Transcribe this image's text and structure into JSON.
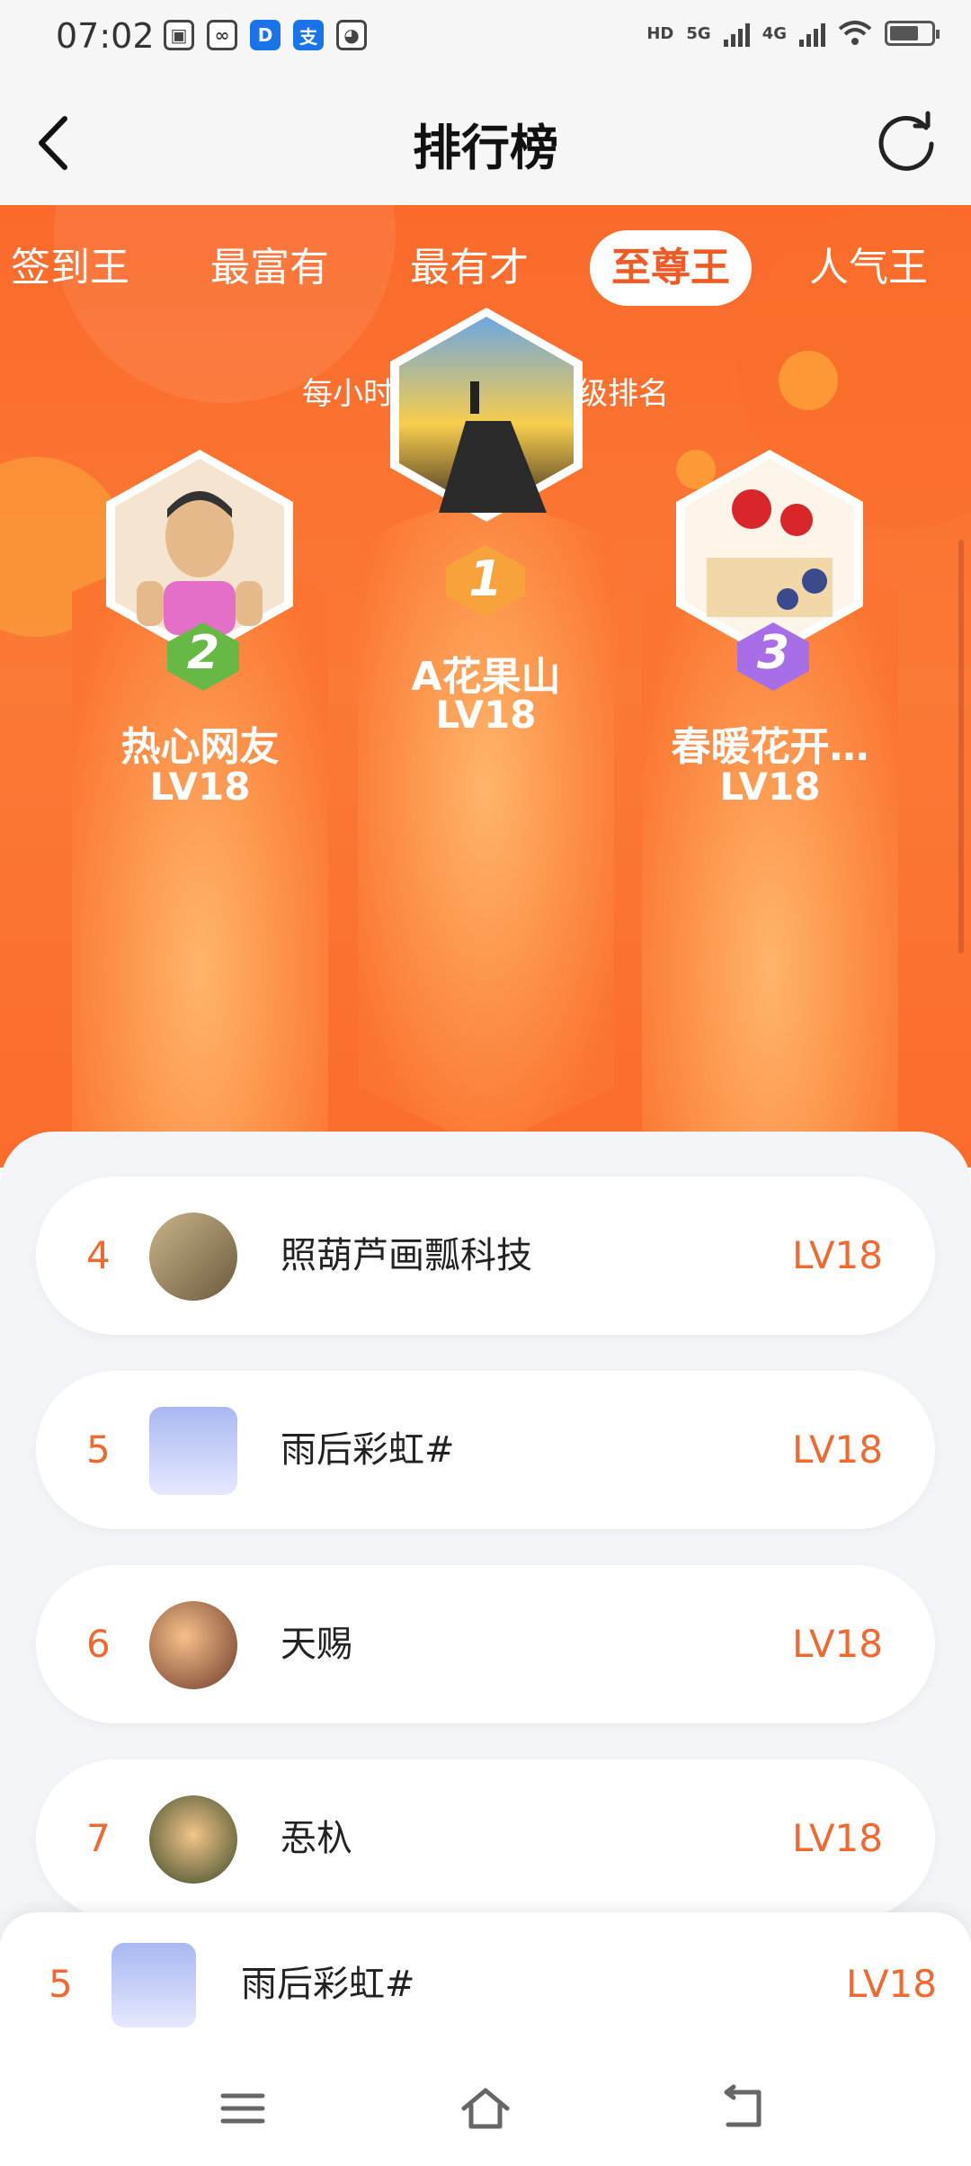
{
  "status_bar": {
    "time": "07:02",
    "notification_icons": [
      "app-icon",
      "ribbon-icon",
      "D",
      "支",
      "cat-icon"
    ],
    "network_left": "HD",
    "network_5g": "5G",
    "network_4g": "4G"
  },
  "header": {
    "title": "排行榜"
  },
  "tabs": [
    {
      "label": "签到王",
      "active": false
    },
    {
      "label": "最富有",
      "active": false
    },
    {
      "label": "最有才",
      "active": false
    },
    {
      "label": "至尊王",
      "active": true
    },
    {
      "label": "人气王",
      "active": false
    }
  ],
  "subtitle": "每小时更新一次，等级排名",
  "podium": {
    "first": {
      "rank": "1",
      "name": "A花果山",
      "level": "LV18"
    },
    "second": {
      "rank": "2",
      "name": "热心网友",
      "level": "LV18"
    },
    "third": {
      "rank": "3",
      "name": "春暖花开…",
      "level": "LV18"
    }
  },
  "list": [
    {
      "rank": "4",
      "name": "照葫芦画瓢科技",
      "level": "LV18"
    },
    {
      "rank": "5",
      "name": "雨后彩虹#",
      "level": "LV18"
    },
    {
      "rank": "6",
      "name": "天赐",
      "level": "LV18"
    },
    {
      "rank": "7",
      "name": "忢杁",
      "level": "LV18"
    }
  ],
  "my_rank": {
    "rank": "5",
    "name": "雨后彩虹#",
    "level": "LV18"
  },
  "colors": {
    "accent": "#f06a30",
    "hero_bg": "#fb6a2b",
    "gold": "#f7a23a",
    "green": "#6cc04a",
    "purple": "#a86ee8"
  }
}
